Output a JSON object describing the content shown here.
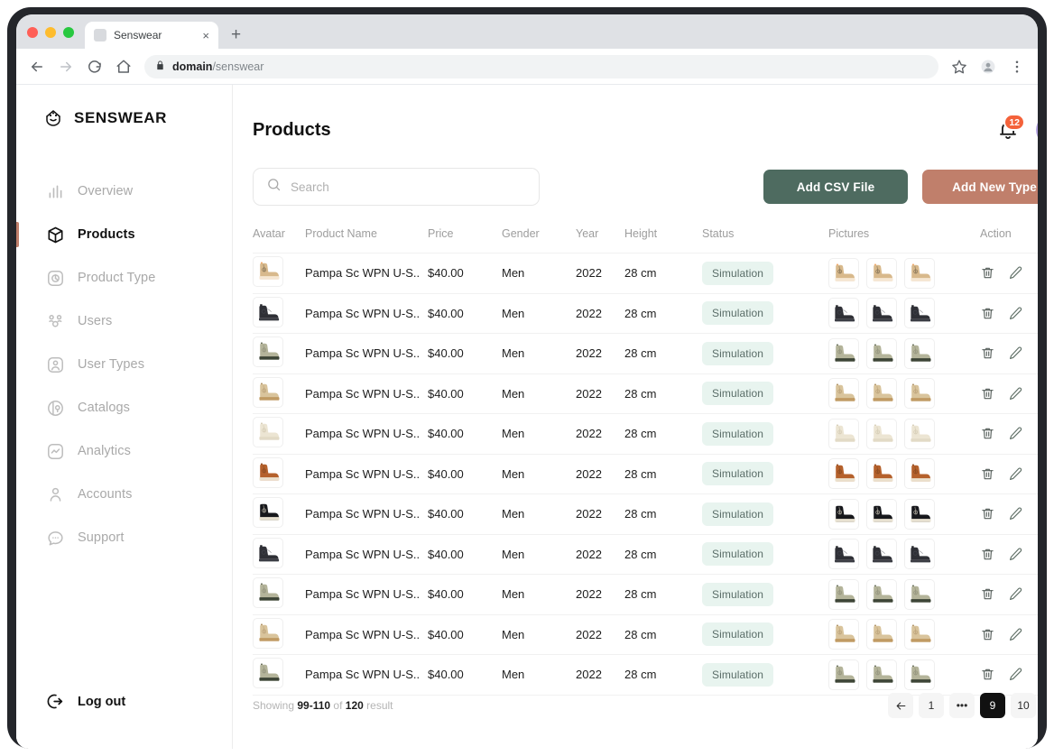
{
  "browser": {
    "tab_title": "Senswear",
    "tab_close": "×",
    "new_tab": "+",
    "url_domain": "domain",
    "url_path": "/senswear",
    "lock_icon": "lock-icon"
  },
  "sidebar": {
    "logo_text": "SENSWEAR",
    "items": [
      {
        "label": "Overview",
        "icon": "bar-chart-icon",
        "active": false
      },
      {
        "label": "Products",
        "icon": "box-icon",
        "active": true
      },
      {
        "label": "Product Type",
        "icon": "tag-circle-icon",
        "active": false
      },
      {
        "label": "Users",
        "icon": "users-icon",
        "active": false
      },
      {
        "label": "User Types",
        "icon": "user-square-icon",
        "active": false
      },
      {
        "label": "Catalogs",
        "icon": "catalog-icon",
        "active": false
      },
      {
        "label": "Analytics",
        "icon": "analytics-icon",
        "active": false
      },
      {
        "label": "Accounts",
        "icon": "account-icon",
        "active": false
      },
      {
        "label": "Support",
        "icon": "chat-icon",
        "active": false
      }
    ],
    "logout_label": "Log out",
    "logout_icon": "logout-icon",
    "active_indicator_color": "#c07f6b"
  },
  "header": {
    "title": "Products",
    "notification_count": "12",
    "notification_icon": "bell-icon",
    "notification_badge_color": "#f4623a",
    "avatar_name": "user-avatar"
  },
  "toolbar": {
    "search_placeholder": "Search",
    "search_value": "",
    "search_icon": "search-icon",
    "add_csv_label": "Add CSV File",
    "add_csv_color": "#4e6b60",
    "add_new_label": "Add New Type",
    "add_new_color": "#c07f6b"
  },
  "table": {
    "columns": [
      "Avatar",
      "Product Name",
      "Price",
      "Gender",
      "Year",
      "Height",
      "Status",
      "Pictures",
      "Action"
    ],
    "status_bg": "#e8f4ef",
    "status_fg": "#5a6d68",
    "rows": [
      {
        "name": "Pampa Sc WPN U-S..",
        "price": "$40.00",
        "gender": "Men",
        "year": "2022",
        "height": "28 cm",
        "status": "Simulation",
        "shoe": {
          "upper": "#d8b98c",
          "sole": "#f6e7d3",
          "accent": "#f4a261",
          "lace": "#6f614a",
          "style": "hi"
        }
      },
      {
        "name": "Pampa Sc WPN U-S..",
        "price": "$40.00",
        "gender": "Men",
        "year": "2022",
        "height": "28 cm",
        "status": "Simulation",
        "shoe": {
          "upper": "#2f3036",
          "sole": "#3b3d44",
          "accent": "#4a4d55",
          "lace": "#1f2025",
          "style": "chelsea"
        }
      },
      {
        "name": "Pampa Sc WPN U-S..",
        "price": "$40.00",
        "gender": "Men",
        "year": "2022",
        "height": "28 cm",
        "status": "Simulation",
        "shoe": {
          "upper": "#b4b49a",
          "sole": "#3c4436",
          "accent": "#5d6552",
          "lace": "#8a8a74",
          "style": "hi"
        }
      },
      {
        "name": "Pampa Sc WPN U-S..",
        "price": "$40.00",
        "gender": "Men",
        "year": "2022",
        "height": "28 cm",
        "status": "Simulation",
        "shoe": {
          "upper": "#d9c49c",
          "sole": "#c09a63",
          "accent": "#a98b5e",
          "lace": "#b39a72",
          "style": "hi"
        }
      },
      {
        "name": "Pampa Sc WPN U-S..",
        "price": "$40.00",
        "gender": "Men",
        "year": "2022",
        "height": "28 cm",
        "status": "Simulation",
        "shoe": {
          "upper": "#ece5d3",
          "sole": "#e2dac6",
          "accent": "#d4cbb4",
          "lace": "#cfc6ae",
          "style": "hi"
        }
      },
      {
        "name": "Pampa Sc WPN U-S..",
        "price": "$40.00",
        "gender": "Men",
        "year": "2022",
        "height": "28 cm",
        "status": "Simulation",
        "shoe": {
          "upper": "#b5612c",
          "sole": "#ece2cf",
          "accent": "#8e4a20",
          "lace": "#7d451f",
          "style": "hi"
        }
      },
      {
        "name": "Pampa Sc WPN U-S..",
        "price": "$40.00",
        "gender": "Men",
        "year": "2022",
        "height": "28 cm",
        "status": "Simulation",
        "shoe": {
          "upper": "#17181c",
          "sole": "#eae3d2",
          "accent": "#ffffff",
          "lace": "#d9d3c2",
          "style": "hi"
        }
      },
      {
        "name": "Pampa Sc WPN U-S..",
        "price": "$40.00",
        "gender": "Men",
        "year": "2022",
        "height": "28 cm",
        "status": "Simulation",
        "shoe": {
          "upper": "#2f3036",
          "sole": "#3b3d44",
          "accent": "#4a4d55",
          "lace": "#1f2025",
          "style": "chelsea"
        }
      },
      {
        "name": "Pampa Sc WPN U-S..",
        "price": "$40.00",
        "gender": "Men",
        "year": "2022",
        "height": "28 cm",
        "status": "Simulation",
        "shoe": {
          "upper": "#b4b49a",
          "sole": "#3c4436",
          "accent": "#5d6552",
          "lace": "#8a8a74",
          "style": "hi"
        }
      },
      {
        "name": "Pampa Sc WPN U-S..",
        "price": "$40.00",
        "gender": "Men",
        "year": "2022",
        "height": "28 cm",
        "status": "Simulation",
        "shoe": {
          "upper": "#d9c49c",
          "sole": "#c09a63",
          "accent": "#a98b5e",
          "lace": "#b39a72",
          "style": "hi"
        }
      },
      {
        "name": "Pampa Sc WPN U-S..",
        "price": "$40.00",
        "gender": "Men",
        "year": "2022",
        "height": "28 cm",
        "status": "Simulation",
        "shoe": {
          "upper": "#b4b49a",
          "sole": "#3c4436",
          "accent": "#5d6552",
          "lace": "#8a8a74",
          "style": "hi"
        }
      }
    ],
    "action_icons": [
      "trash-icon",
      "pencil-icon",
      "arrow-right-icon"
    ],
    "pictures_per_row": 3
  },
  "footer": {
    "showing_prefix": "Showing",
    "showing_range": "99-110",
    "showing_of": "of",
    "showing_total": "120",
    "showing_suffix": "result",
    "pagination": {
      "prev_icon": "arrow-left-icon",
      "next_icon": "arrow-right-icon",
      "pages": [
        "1",
        "•••",
        "9",
        "10"
      ],
      "active_page": "9"
    }
  }
}
